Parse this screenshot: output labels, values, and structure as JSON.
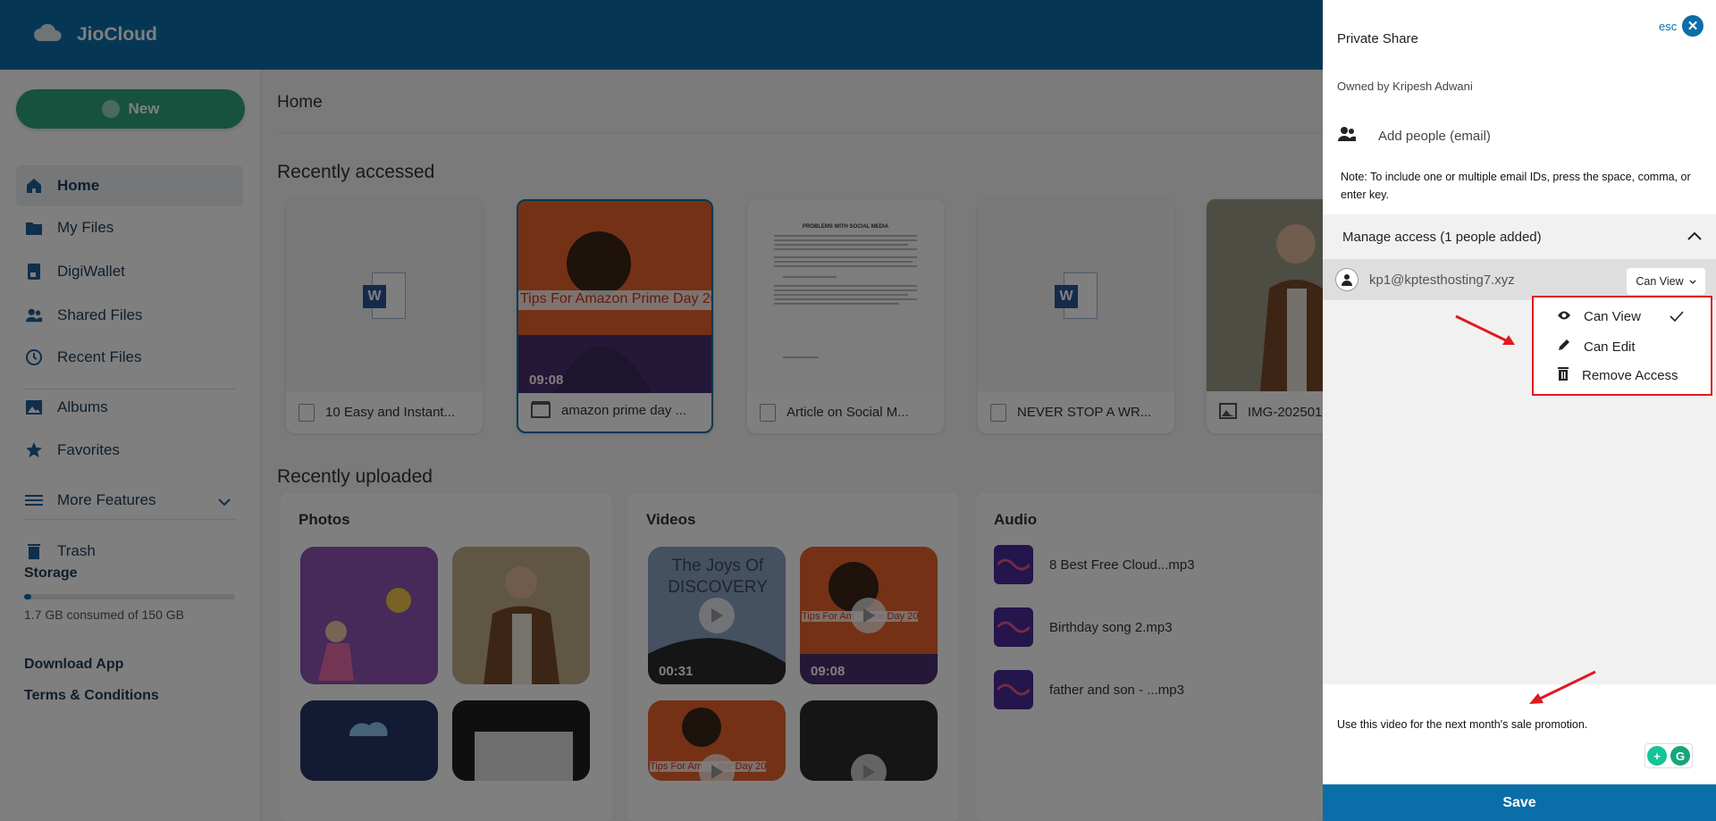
{
  "app": {
    "name": "JioCloud"
  },
  "sidebar": {
    "new_label": "New",
    "items": [
      {
        "label": "Home",
        "icon": "home-icon"
      },
      {
        "label": "My Files",
        "icon": "folder-icon"
      },
      {
        "label": "DigiWallet",
        "icon": "wallet-icon"
      },
      {
        "label": "Shared Files",
        "icon": "people-icon"
      },
      {
        "label": "Recent Files",
        "icon": "history-icon"
      },
      {
        "label": "Albums",
        "icon": "image-icon"
      },
      {
        "label": "Favorites",
        "icon": "star-icon"
      },
      {
        "label": "More Features",
        "icon": "menu-icon"
      },
      {
        "label": "Trash",
        "icon": "trash-icon"
      }
    ],
    "storage": {
      "title": "Storage",
      "used_text": "1.7 GB consumed of 150 GB",
      "fraction": 0.011
    },
    "links": {
      "download": "Download App",
      "terms": "Terms & Conditions"
    }
  },
  "main": {
    "title": "Home",
    "recently_accessed": {
      "title": "Recently accessed",
      "cards": [
        {
          "name": "10 Easy and Instant...",
          "type": "word"
        },
        {
          "name": "amazon prime day ...",
          "type": "video",
          "duration": "09:08",
          "thumb_text": "Tips For Amazon Prime Day 20"
        },
        {
          "name": "Article on Social M...",
          "type": "word",
          "thumb_text": "PROBLEMS WITH SOCIAL MEDIA"
        },
        {
          "name": "NEVER STOP A WR...",
          "type": "word"
        },
        {
          "name": "IMG-202501",
          "type": "image"
        }
      ]
    },
    "recently_uploaded": {
      "title": "Recently uploaded",
      "photos_title": "Photos",
      "videos_title": "Videos",
      "audio_title": "Audio",
      "videos": [
        {
          "thumb_text": "The Joys Of DISCOVERY",
          "duration": "00:31"
        },
        {
          "thumb_text": "Tips For Am      me Day 20",
          "duration": "09:08"
        },
        {
          "thumb_text": "Tips For Am      me Day 20",
          "duration": ""
        },
        {
          "thumb_text": "",
          "duration": ""
        }
      ],
      "audio": [
        "8 Best Free Cloud...mp3",
        "Birthday song 2.mp3",
        "father and son - ...mp3"
      ]
    }
  },
  "drawer": {
    "esc": "esc",
    "title": "Private Share",
    "owner": "Owned by Kripesh Adwani",
    "add_people_placeholder": "Add people (email)",
    "note": "Note: To include one or multiple email IDs, press the space, comma, or enter key.",
    "manage_access": "Manage access (1 people added)",
    "person": {
      "email": "kp1@kptesthosting7.xyz",
      "permission": "Can View"
    },
    "dropdown": [
      "Can View",
      "Can Edit",
      "Remove Access"
    ],
    "message": "Use this video for the next month's sale promotion.",
    "save_label": "Save"
  },
  "colors": {
    "header": "#0b6ea8",
    "new_button": "#2ea57c",
    "annotation": "#e0191f"
  }
}
